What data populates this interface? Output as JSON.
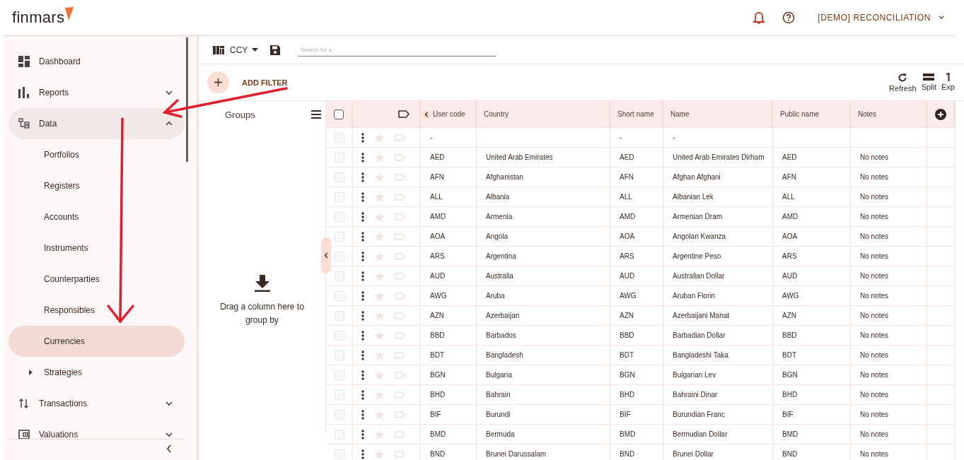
{
  "header": {
    "logo": "finmars",
    "workspace": "[DEMO] RECONCILIATION"
  },
  "sidebar": {
    "items": [
      {
        "label": "Dashboard",
        "selected": false
      },
      {
        "label": "Reports",
        "selected": false,
        "expanded": false
      },
      {
        "label": "Data",
        "selected": false,
        "expanded": true,
        "children": [
          {
            "label": "Portfolios",
            "selected": false
          },
          {
            "label": "Registers",
            "selected": false
          },
          {
            "label": "Accounts",
            "selected": false
          },
          {
            "label": "Instruments",
            "selected": false
          },
          {
            "label": "Counterparties",
            "selected": false
          },
          {
            "label": "Responsibles",
            "selected": false
          },
          {
            "label": "Currencies",
            "selected": true
          },
          {
            "label": "Strategies",
            "selected": false,
            "expanded": false
          }
        ]
      },
      {
        "label": "Transactions",
        "selected": false,
        "expanded": false
      },
      {
        "label": "Valuations",
        "selected": false,
        "expanded": false
      }
    ]
  },
  "toolbar": {
    "layout": "CCY",
    "search": {
      "placeholder": "Search for a ..."
    },
    "add_filter": "ADD FILTER",
    "actions": [
      "Refresh",
      "Split",
      "Exp"
    ]
  },
  "groups": {
    "title": "Groups",
    "hint": "Drag a column here to group by"
  },
  "table": {
    "all_checked": false,
    "columns": [
      "User code",
      "Country",
      "Short name",
      "Name",
      "Public name",
      "Notes"
    ],
    "rows": [
      {
        "checked": false,
        "cells": [
          "-",
          null,
          "-",
          "-",
          null,
          null
        ]
      },
      {
        "checked": false,
        "cells": [
          "AED",
          "United Arab Emirates",
          "AED",
          "United Arab Emirates Dirham",
          "AED",
          "No notes"
        ]
      },
      {
        "checked": false,
        "cells": [
          "AFN",
          "Afghanistan",
          "AFN",
          "Afghan Afghani",
          "AFN",
          "No notes"
        ]
      },
      {
        "checked": false,
        "cells": [
          "ALL",
          "Albania",
          "ALL",
          "Albanian Lek",
          "ALL",
          "No notes"
        ]
      },
      {
        "checked": false,
        "cells": [
          "AMD",
          "Armenia",
          "AMD",
          "Armenian Dram",
          "AMD",
          "No notes"
        ]
      },
      {
        "checked": false,
        "cells": [
          "AOA",
          "Angola",
          "AOA",
          "Angolan Kwanza",
          "AOA",
          "No notes"
        ]
      },
      {
        "checked": false,
        "cells": [
          "ARS",
          "Argentina",
          "ARS",
          "Argentine Peso",
          "ARS",
          "No notes"
        ]
      },
      {
        "checked": false,
        "cells": [
          "AUD",
          "Australia",
          "AUD",
          "Australian Dollar",
          "AUD",
          "No notes"
        ]
      },
      {
        "checked": false,
        "cells": [
          "AWG",
          "Aruba",
          "AWG",
          "Aruban Florin",
          "AWG",
          "No notes"
        ]
      },
      {
        "checked": false,
        "cells": [
          "AZN",
          "Azerbaijan",
          "AZN",
          "Azerbaijani Manat",
          "AZN",
          "No notes"
        ]
      },
      {
        "checked": false,
        "cells": [
          "BBD",
          "Barbados",
          "BBD",
          "Barbadian Dollar",
          "BBD",
          "No notes"
        ]
      },
      {
        "checked": false,
        "cells": [
          "BDT",
          "Bangladesh",
          "BDT",
          "Bangladeshi Taka",
          "BDT",
          "No notes"
        ]
      },
      {
        "checked": false,
        "cells": [
          "BGN",
          "Bulgaria",
          "BGN",
          "Bulgarian Lev",
          "BGN",
          "No notes"
        ]
      },
      {
        "checked": false,
        "cells": [
          "BHD",
          "Bahrain",
          "BHD",
          "Bahraini Dinar",
          "BHD",
          "No notes"
        ]
      },
      {
        "checked": false,
        "cells": [
          "BIF",
          "Burundi",
          "BIF",
          "Burundian Franc",
          "BIF",
          "No notes"
        ]
      },
      {
        "checked": false,
        "cells": [
          "BMD",
          "Bermuda",
          "BMD",
          "Bermudian Dollar",
          "BMD",
          "No notes"
        ]
      },
      {
        "checked": false,
        "cells": [
          "BND",
          "Brunei Darussalam",
          "BND",
          "Brunei Dollar",
          "BND",
          "No notes"
        ]
      }
    ]
  }
}
